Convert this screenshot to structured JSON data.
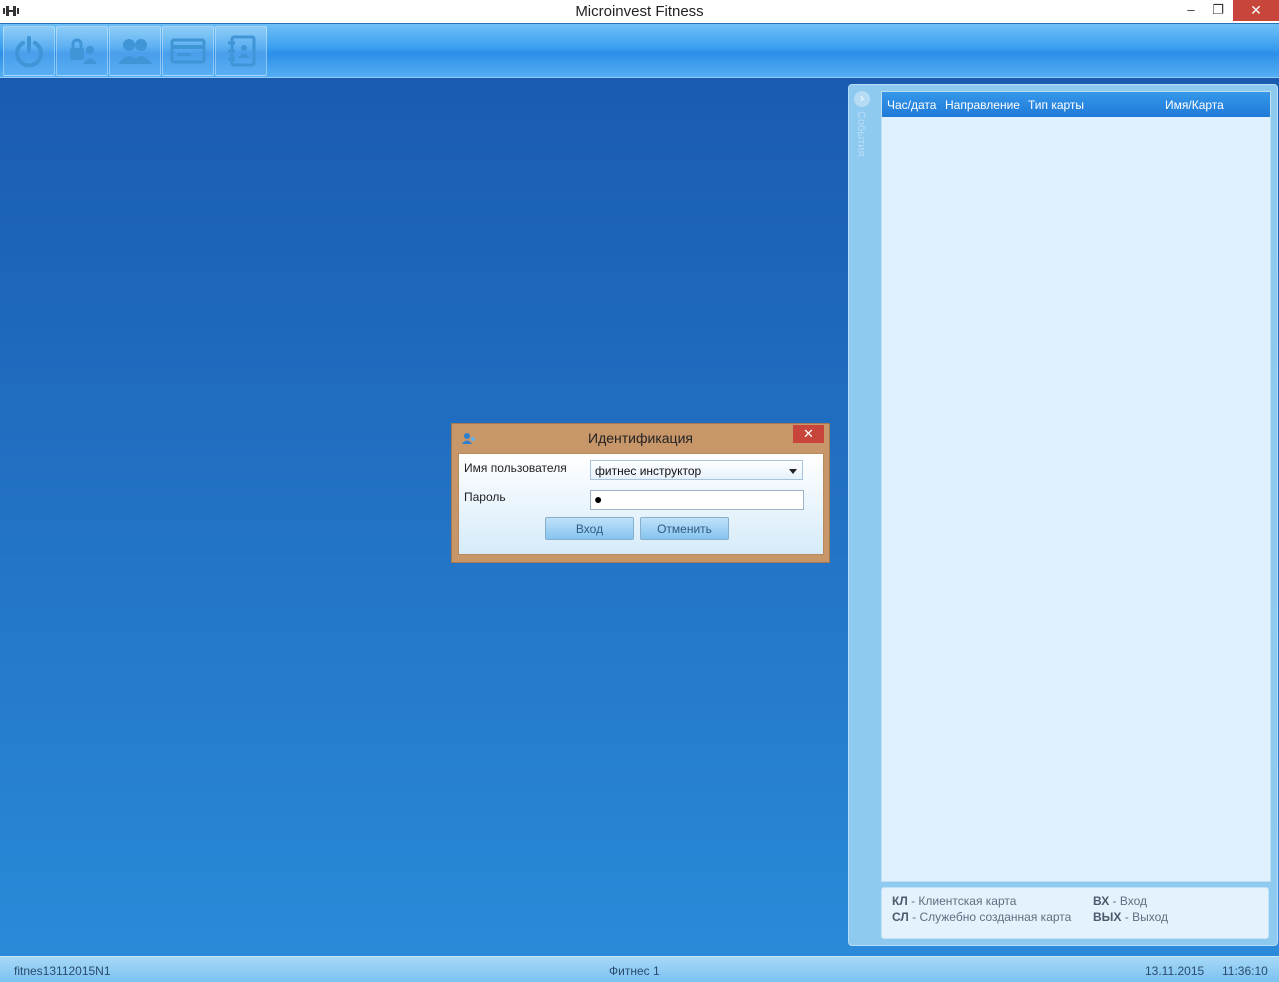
{
  "window": {
    "title": "Microinvest Fitness",
    "controls": {
      "minimize": "‒",
      "maximize": "❐",
      "close": "✕"
    }
  },
  "toolbar": {
    "buttons": [
      {
        "name": "power-button",
        "icon": "power-icon"
      },
      {
        "name": "lock-users-button",
        "icon": "lock-user-icon"
      },
      {
        "name": "users-button",
        "icon": "users-icon"
      },
      {
        "name": "card-button",
        "icon": "card-icon"
      },
      {
        "name": "book-button",
        "icon": "book-icon"
      }
    ]
  },
  "events": {
    "toggle": "›",
    "side_label": "События",
    "columns": [
      "Час/дата",
      "Направление",
      "Тип карты",
      "Имя/Карта"
    ],
    "rows": [],
    "legend": [
      {
        "code": "КЛ",
        "text": " - Клиентская карта"
      },
      {
        "code": "СЛ",
        "text": " - Служебно созданная карта"
      },
      {
        "code": "ВХ",
        "text": " - Вход"
      },
      {
        "code": "ВЫХ",
        "text": " - Выход"
      }
    ]
  },
  "login_dialog": {
    "title": "Идентификация",
    "close": "✕",
    "username_label": "Имя пользователя",
    "username_value": "фитнес инструктор",
    "password_label": "Пароль",
    "password_value": "●",
    "login_button": "Вход",
    "cancel_button": "Отменить"
  },
  "status": {
    "database": "fitnes13112015N1",
    "location": "Фитнес 1",
    "date": "13.11.2015",
    "time": "11:36:10"
  },
  "colors": {
    "desktop_top": "#1a5bb0",
    "desktop_bottom": "#2a8ad9",
    "dialog_frame": "#c79669",
    "close_red": "#c7453a",
    "header_blue": "#1f7ad8"
  }
}
